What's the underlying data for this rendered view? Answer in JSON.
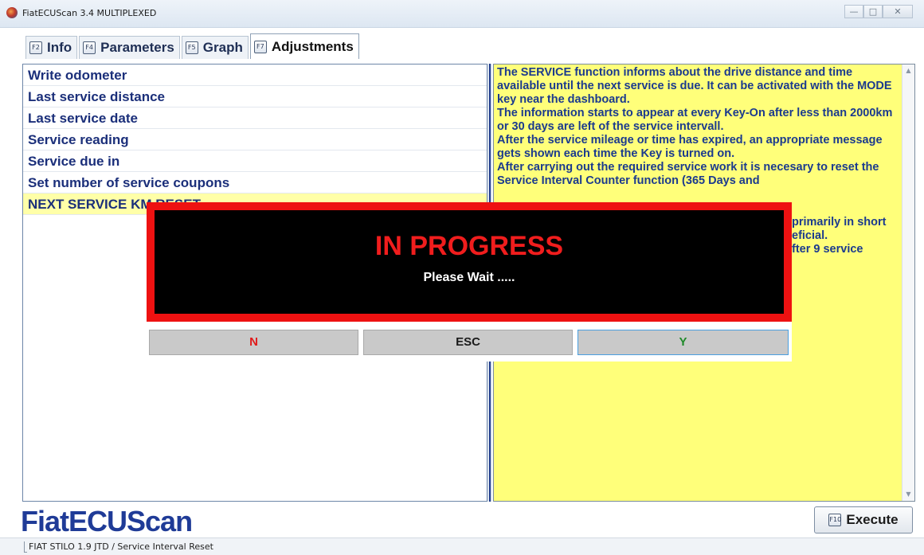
{
  "window": {
    "title": "FiatECUScan 3.4 MULTIPLEXED",
    "minimize_glyph": "—",
    "maximize_glyph": "□",
    "close_glyph": "✕"
  },
  "tabs": [
    {
      "key": "F2",
      "label": "Info"
    },
    {
      "key": "F4",
      "label": "Parameters"
    },
    {
      "key": "F5",
      "label": "Graph"
    },
    {
      "key": "F7",
      "label": "Adjustments"
    }
  ],
  "list": {
    "items": [
      "Write odometer",
      "Last service distance",
      "Last service date",
      "Service reading",
      "Service due in",
      "Set number of service coupons",
      "NEXT SERVICE KM RESET"
    ]
  },
  "help": {
    "text": "The SERVICE function informs about the drive distance and time available until the next service is due. It can be activated with the MODE key near the dashboard.\nThe information starts to appear at every Key-On after less than 2000km or 30 days are left of the service intervall.\nAfter the service mileage or time has expired, an appropriate message gets shown each time the Key is turned on.\nAfter carrying out the required service work it is necesary to reset the Service Interval Counter function (365 Days and",
    "text_fragment_1": "primarily in short",
    "text_fragment_2": "eficial.",
    "text_fragment_3": "fter 9 service"
  },
  "modal": {
    "title": "IN PROGRESS",
    "subtitle": "Please Wait .....",
    "buttons": {
      "n": "N",
      "esc": "ESC",
      "y": "Y"
    }
  },
  "footer": {
    "logo": "FiatECUScan",
    "execute_key": "F10",
    "execute_label": "Execute",
    "status": "FIAT STILO 1.9 JTD / Service Interval Reset"
  },
  "colors": {
    "accent_navy": "#1b2f7a",
    "help_bg": "#ffff7a",
    "progress_border": "#ee1111",
    "n_color": "#e11b1b",
    "y_color": "#1f8a2a"
  }
}
